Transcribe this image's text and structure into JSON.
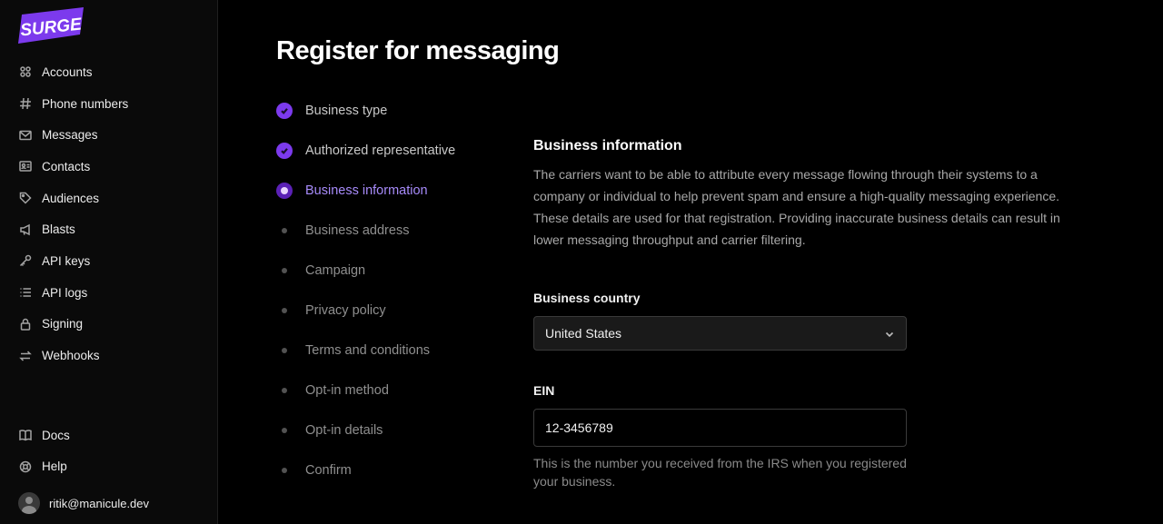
{
  "brand": {
    "name": "SURGE",
    "color": "#7c3aed"
  },
  "sidebar": {
    "items": [
      {
        "label": "Accounts",
        "icon": "accounts-icon"
      },
      {
        "label": "Phone numbers",
        "icon": "hash-icon"
      },
      {
        "label": "Messages",
        "icon": "envelope-icon"
      },
      {
        "label": "Contacts",
        "icon": "contact-card-icon"
      },
      {
        "label": "Audiences",
        "icon": "tag-icon"
      },
      {
        "label": "Blasts",
        "icon": "megaphone-icon"
      },
      {
        "label": "API keys",
        "icon": "key-icon"
      },
      {
        "label": "API logs",
        "icon": "list-icon"
      },
      {
        "label": "Signing",
        "icon": "lock-icon"
      },
      {
        "label": "Webhooks",
        "icon": "arrows-exchange-icon"
      }
    ],
    "bottom": [
      {
        "label": "Docs",
        "icon": "book-icon"
      },
      {
        "label": "Help",
        "icon": "help-icon"
      }
    ],
    "user": {
      "email": "ritik@manicule.dev"
    }
  },
  "page": {
    "title": "Register for messaging"
  },
  "steps": [
    {
      "label": "Business type",
      "status": "done"
    },
    {
      "label": "Authorized representative",
      "status": "done"
    },
    {
      "label": "Business information",
      "status": "current"
    },
    {
      "label": "Business address",
      "status": "pending"
    },
    {
      "label": "Campaign",
      "status": "pending"
    },
    {
      "label": "Privacy policy",
      "status": "pending"
    },
    {
      "label": "Terms and conditions",
      "status": "pending"
    },
    {
      "label": "Opt-in method",
      "status": "pending"
    },
    {
      "label": "Opt-in details",
      "status": "pending"
    },
    {
      "label": "Confirm",
      "status": "pending"
    }
  ],
  "form": {
    "title": "Business information",
    "description": "The carriers want to be able to attribute every message flowing through their systems to a company or individual to help prevent spam and ensure a high-quality messaging experience. These details are used for that registration. Providing inaccurate business details can result in lower messaging throughput and carrier filtering.",
    "country": {
      "label": "Business country",
      "value": "United States"
    },
    "ein": {
      "label": "EIN",
      "value": "12-3456789",
      "help": "This is the number you received from the IRS when you registered your business."
    }
  }
}
